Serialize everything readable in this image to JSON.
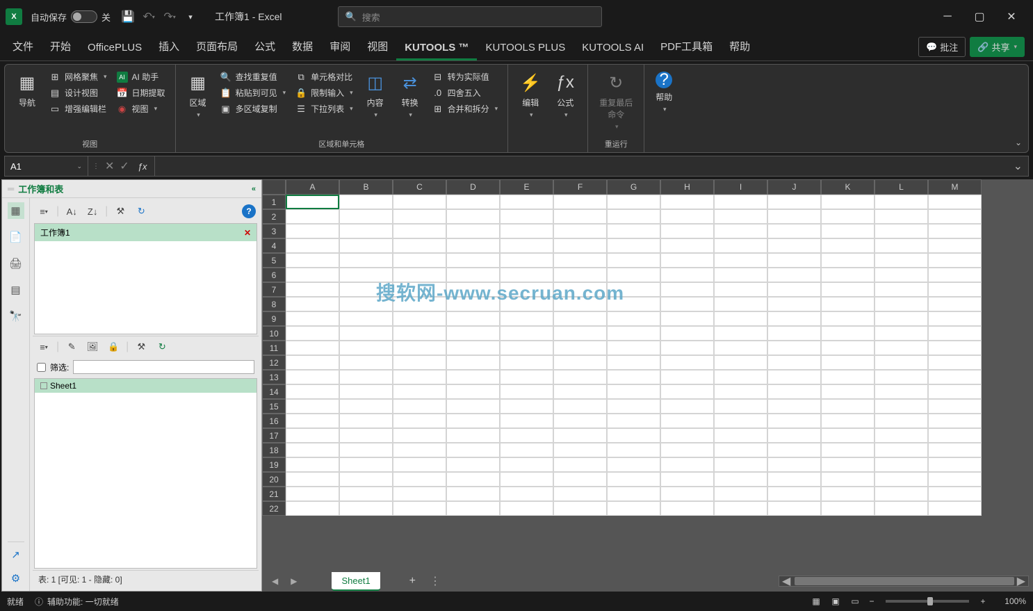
{
  "titlebar": {
    "autosave_label": "自动保存",
    "autosave_state": "关",
    "doc_title": "工作簿1 - Excel",
    "search_placeholder": "搜索"
  },
  "tabs": {
    "file": "文件",
    "home": "开始",
    "officeplus": "OfficePLUS",
    "insert": "插入",
    "layout": "页面布局",
    "formula": "公式",
    "data": "数据",
    "review": "审阅",
    "view": "视图",
    "kutools": "KUTOOLS ™",
    "kutools_plus": "KUTOOLS PLUS",
    "kutools_ai": "KUTOOLS AI",
    "pdf": "PDF工具箱",
    "help": "帮助",
    "comments": "批注",
    "share": "共享"
  },
  "ribbon": {
    "nav": "导航",
    "views_group": "视图",
    "grid_focus": "网格聚焦",
    "design_view": "设计视图",
    "enhance_bar": "增强编辑栏",
    "ai_helper": "AI 助手",
    "date_extract": "日期提取",
    "view_dd": "视图",
    "region": "区域",
    "region_cells_group": "区域和单元格",
    "find_dup": "查找重复值",
    "paste_visible": "粘贴到可见",
    "multi_copy": "多区域复制",
    "cell_compare": "单元格对比",
    "limit_input": "限制输入",
    "dropdown_list": "下拉列表",
    "content": "内容",
    "convert": "转换",
    "to_actual": "转为实际值",
    "round": "四舍五入",
    "merge_split": "合并和拆分",
    "edit": "编辑",
    "fx": "公式",
    "repeat_last": "重复最后\n命令",
    "rerun_group": "重运行",
    "help_btn": "帮助"
  },
  "formula_bar": {
    "name_box": "A1"
  },
  "sidepane": {
    "title": "工作簿和表",
    "workbook": "工作簿1",
    "filter_label": "筛选:",
    "sheet1": "Sheet1",
    "status": "表: 1  [可见: 1 - 隐藏: 0]"
  },
  "grid": {
    "columns": [
      "A",
      "B",
      "C",
      "D",
      "E",
      "F",
      "G",
      "H",
      "I",
      "J",
      "K",
      "L",
      "M"
    ],
    "rows": [
      1,
      2,
      3,
      4,
      5,
      6,
      7,
      8,
      9,
      10,
      11,
      12,
      13,
      14,
      15,
      16,
      17,
      18,
      19,
      20,
      21,
      22
    ],
    "watermark": "搜软网-www.secruan.com"
  },
  "sheet_tabs": {
    "sheet1": "Sheet1"
  },
  "statusbar": {
    "ready": "就绪",
    "accessibility": "辅助功能: 一切就绪",
    "zoom": "100%"
  }
}
